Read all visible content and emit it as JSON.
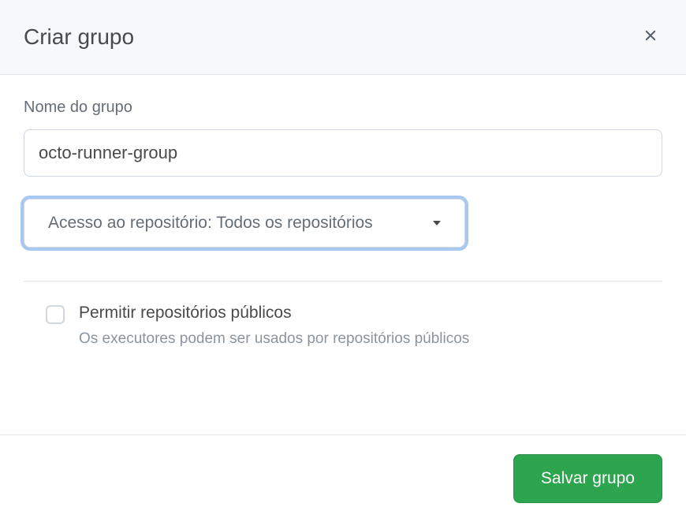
{
  "header": {
    "title": "Criar grupo"
  },
  "form": {
    "group_name_label": "Nome do grupo",
    "group_name_value": "octo-runner-group",
    "repo_access_label": "Acesso ao repositório: Todos os repositórios",
    "allow_public_label": "Permitir repositórios públicos",
    "allow_public_desc": "Os executores podem ser usados por repositórios públicos"
  },
  "footer": {
    "save_label": "Salvar grupo"
  }
}
